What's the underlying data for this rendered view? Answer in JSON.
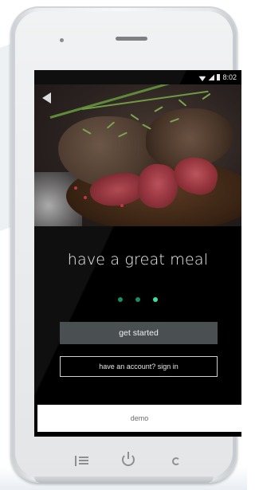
{
  "status_bar": {
    "time": "8:02",
    "icons": [
      "wifi-icon",
      "signal-icon",
      "battery-icon"
    ]
  },
  "hero": {
    "image": "steak-with-rosemary-photo"
  },
  "onboarding": {
    "headline": "have a great meal",
    "page_indicator": {
      "total": 3,
      "active_index": 2
    }
  },
  "actions": {
    "get_started": "get started",
    "sign_in": "have an account? sign in",
    "demo": "demo"
  },
  "device_keys": [
    "menu-icon",
    "power-icon",
    "refresh-icon"
  ],
  "colors": {
    "screen_bg": "#000000",
    "indicator": "#1f8a67",
    "indicator_active": "#3be0a0",
    "primary_button": "#4a4f52",
    "demo_button": "#ffffff"
  }
}
